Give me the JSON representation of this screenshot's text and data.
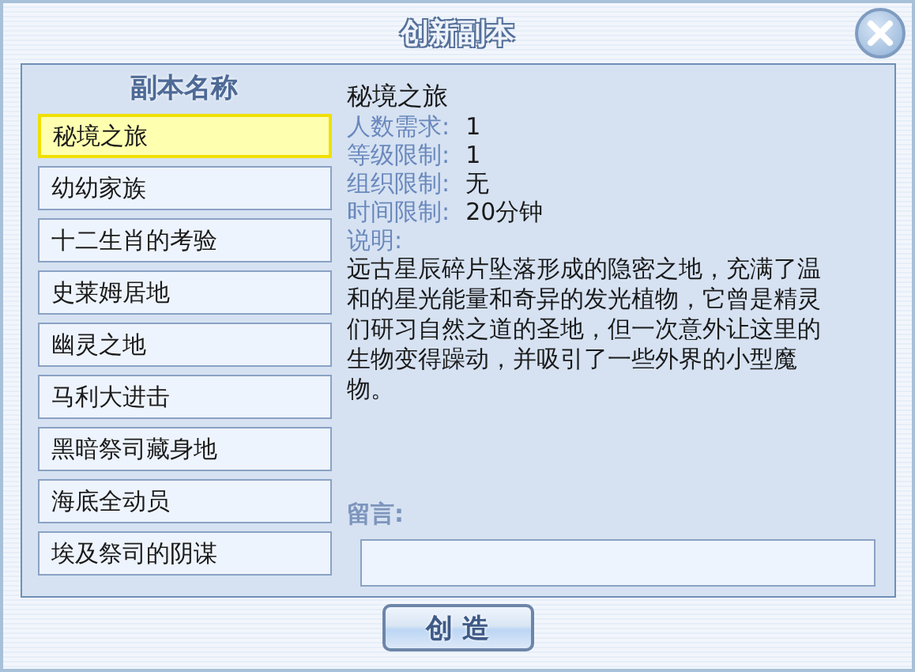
{
  "window": {
    "title": "创新副本"
  },
  "list": {
    "heading": "副本名称",
    "items": [
      {
        "label": "秘境之旅",
        "selected": true
      },
      {
        "label": "幼幼家族",
        "selected": false
      },
      {
        "label": "十二生肖的考验",
        "selected": false
      },
      {
        "label": "史莱姆居地",
        "selected": false
      },
      {
        "label": "幽灵之地",
        "selected": false
      },
      {
        "label": "马利大进击",
        "selected": false
      },
      {
        "label": "黑暗祭司藏身地",
        "selected": false
      },
      {
        "label": "海底全动员",
        "selected": false
      },
      {
        "label": "埃及祭司的阴谋",
        "selected": false
      }
    ]
  },
  "details": {
    "name": "秘境之旅",
    "fields": [
      {
        "label": "人数需求:",
        "value": "1"
      },
      {
        "label": "等级限制:",
        "value": "1"
      },
      {
        "label": "组织限制:",
        "value": "无"
      },
      {
        "label": "时间限制:",
        "value": "20分钟"
      }
    ],
    "description_label": "说明:",
    "description": "远古星辰碎片坠落形成的隐密之地，充满了温和的星光能量和奇异的发光植物，它曾是精灵们研习自然之道的圣地，但一次意外让这里的生物变得躁动，并吸引了一些外界的小型魔物。",
    "message_label": "留言:"
  },
  "buttons": [
    "创 造"
  ]
}
